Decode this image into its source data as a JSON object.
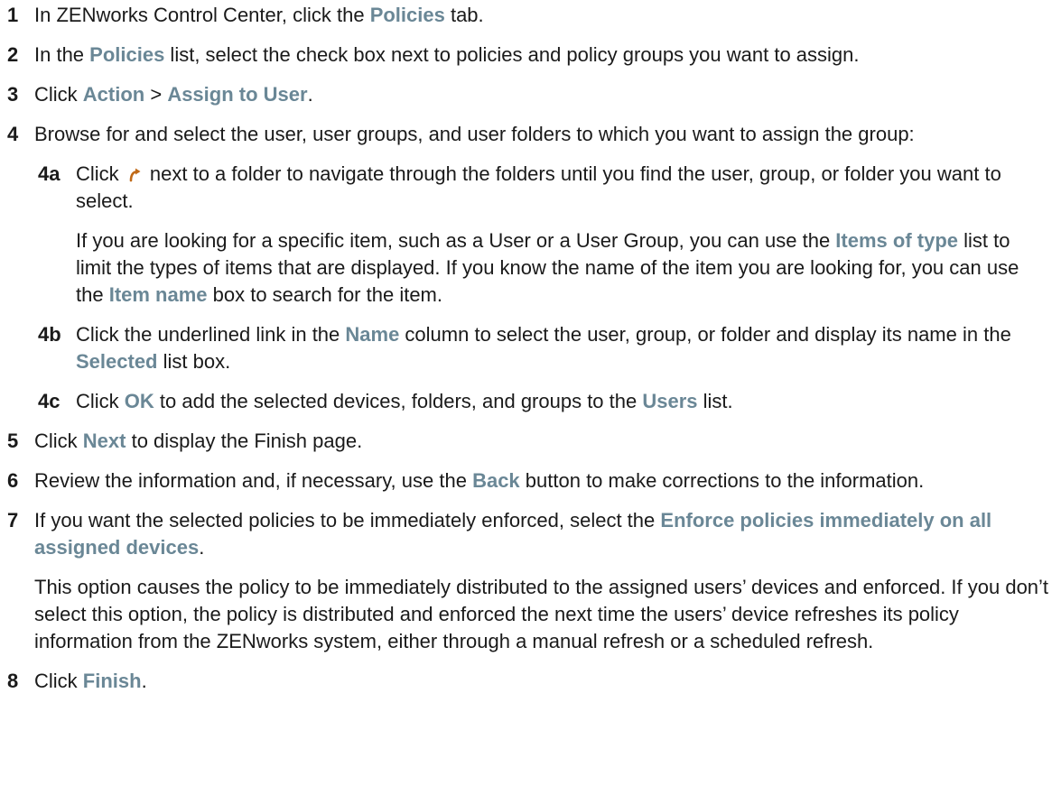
{
  "steps": [
    {
      "num": "1",
      "t0": "In ZENworks Control Center, click the ",
      "u0": "Policies",
      "t1": " tab."
    },
    {
      "num": "2",
      "t0": "In the ",
      "u0": "Policies",
      "t1": " list, select the check box next to policies and policy groups you want to assign."
    },
    {
      "num": "3",
      "t0": "Click ",
      "u0": "Action",
      "t1": " > ",
      "u1": "Assign to User",
      "t2": "."
    },
    {
      "num": "4",
      "t0": "Browse for and select the user, user groups, and user folders to which you want to assign the group:"
    },
    {
      "num": "5",
      "t0": "Click ",
      "u0": "Next",
      "t1": " to display the Finish page."
    },
    {
      "num": "6",
      "t0": "Review the information and, if necessary, use the ",
      "u0": "Back",
      "t1": " button to make corrections to the information."
    },
    {
      "num": "7",
      "t0": "If you want the selected policies to be immediately enforced, select the ",
      "u0": "Enforce policies immediately on all assigned devices",
      "t1": "."
    },
    {
      "num": "8",
      "t0": "Click ",
      "u0": "Finish",
      "t1": "."
    }
  ],
  "substeps": [
    {
      "num": "4a",
      "t0": "Click ",
      "t1": " next to a folder to navigate through the folders until you find the user, group, or folder you want to select."
    },
    {
      "num": "4b",
      "t0": "Click the underlined link in the ",
      "u0": "Name",
      "t1": " column to select the user, group, or folder and display its name in the ",
      "u1": "Selected",
      "t2": " list box."
    },
    {
      "num": "4c",
      "t0": "Click ",
      "u0": "OK",
      "t1": " to add the selected devices, folders, and groups to the ",
      "u1": "Users",
      "t2": " list."
    }
  ],
  "para4a": {
    "t0": "If you are looking for a specific item, such as a User or a User Group, you can use the ",
    "u0": "Items of type",
    "t1": " list to limit the types of items that are displayed. If you know the name of the item you are looking for, you can use the ",
    "u1": "Item name",
    "t2": " box to search for the item."
  },
  "note7": "This option causes the policy to be immediately distributed to the assigned users’ devices and enforced. If you don’t select this option, the policy is distributed and enforced the next time the users’ device refreshes its policy information from the ZENworks system, either through a manual refresh or a scheduled refresh.",
  "icons": {
    "navigate": "folder-navigate-arrow-icon"
  },
  "colors": {
    "ui_term": "#6a8796",
    "text": "#1a1a1a"
  }
}
